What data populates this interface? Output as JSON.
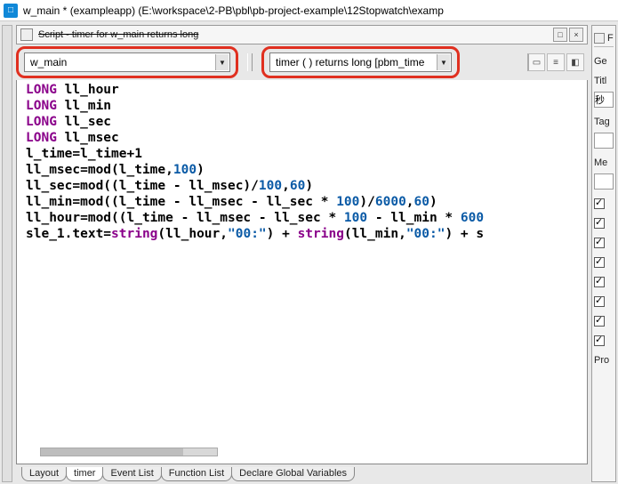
{
  "titlebar": {
    "icon_letter": "□",
    "text": "w_main * (exampleapp) (E:\\workspace\\2-PB\\pbl\\pb-project-example\\12Stopwatch\\examp"
  },
  "script_header": {
    "text": "Script - timer for w_main returns long"
  },
  "object_combo": {
    "value": "w_main"
  },
  "event_combo": {
    "value": "timer ( )  returns long [pbm_time"
  },
  "header_icons": [
    "□",
    "×"
  ],
  "tool_icons": [
    "▭",
    "≡",
    "◧"
  ],
  "code": {
    "l1_kw": "LONG",
    "l1_id": "ll_hour",
    "l2_kw": "LONG",
    "l2_id": "ll_min",
    "l3_kw": "LONG",
    "l3_id": "ll_sec",
    "l4_kw": "LONG",
    "l4_id": "ll_msec",
    "l5": "l_time=l_time+1",
    "l6a": "ll_msec=mod(l_time,",
    "l6n": "100",
    "l6b": ")",
    "l7a": "ll_sec=mod((l_time - ll_msec)/",
    "l7n1": "100",
    "l7m": ",",
    "l7n2": "60",
    "l7b": ")",
    "l8a": "ll_min=mod((l_time - ll_msec - ll_sec * ",
    "l8n1": "100",
    "l8m": ")/",
    "l8n2": "6000",
    "l8c": ",",
    "l8n3": "60",
    "l8b": ")",
    "l9a": "ll_hour=mod((l_time - ll_msec - ll_sec * ",
    "l9n1": "100",
    "l9m": " - ll_min * ",
    "l9n2": "600",
    "l10a": "sle_1.text=",
    "l10fn1": "string",
    "l10b": "(ll_hour,",
    "l10s1": "\"00:\"",
    "l10c": ") + ",
    "l10fn2": "string",
    "l10d": "(ll_min,",
    "l10s2": "\"00:\"",
    "l10e": ") + s"
  },
  "tabs": [
    "Layout",
    "timer",
    "Event List",
    "Function List",
    "Declare Global Variables"
  ],
  "active_tab_index": 1,
  "right_panel": {
    "header_letter": "F",
    "section1": "Ge",
    "label_title": "Titl",
    "value_title": "秒",
    "label_tag": "Tag",
    "label_me": "Me",
    "checks": [
      true,
      true,
      true,
      true,
      true,
      true,
      true,
      true,
      true,
      true
    ],
    "section2": "Pro"
  }
}
